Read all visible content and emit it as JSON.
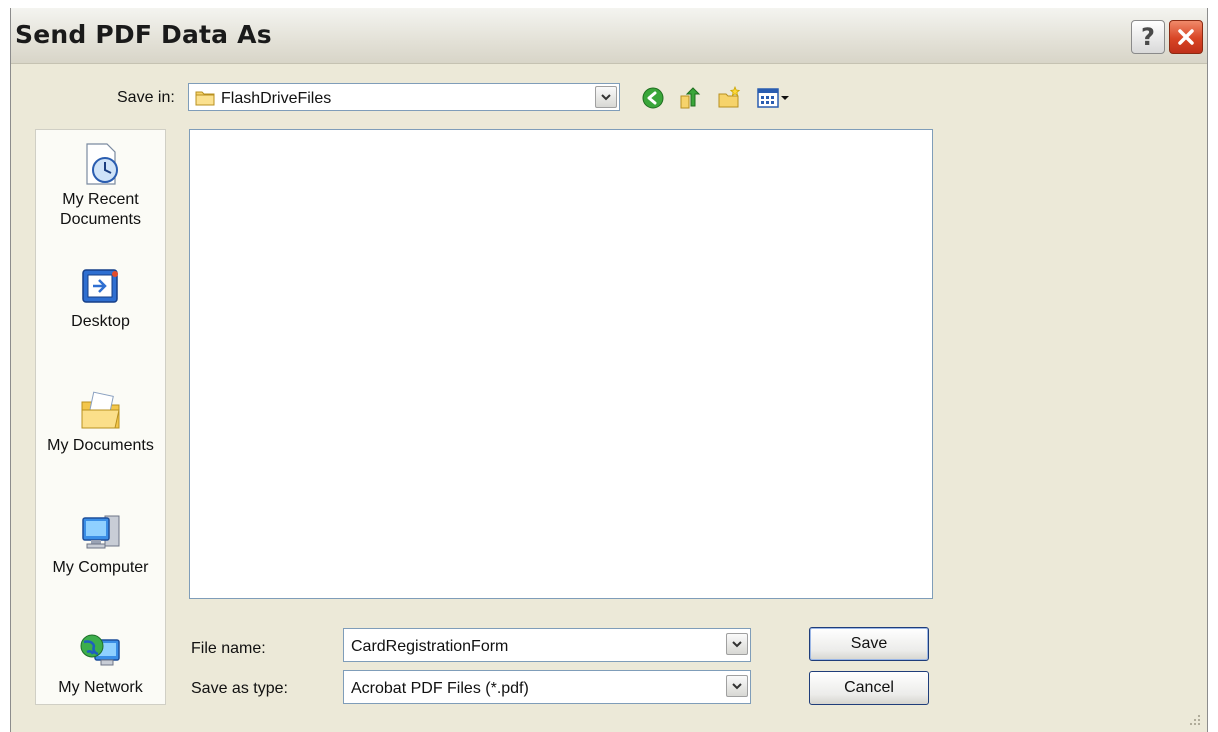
{
  "window": {
    "title": "Send PDF Data As",
    "help_icon": "help-icon",
    "close_icon": "close-icon"
  },
  "save_in": {
    "label": "Save in:",
    "value": "FlashDriveFiles",
    "icon": "folder-icon"
  },
  "toolbar": {
    "icons": [
      "back-icon",
      "up-folder-icon",
      "new-folder-icon",
      "view-menu-icon"
    ]
  },
  "places": [
    {
      "label": "My Recent Documents",
      "line1": "My Recent",
      "line2": "Documents",
      "icon": "recent-documents-icon"
    },
    {
      "label": "Desktop",
      "icon": "desktop-icon"
    },
    {
      "label": "My Documents",
      "icon": "my-documents-icon"
    },
    {
      "label": "My Computer",
      "icon": "my-computer-icon"
    },
    {
      "label": "My Network",
      "icon": "my-network-icon"
    }
  ],
  "file_name": {
    "label": "File name:",
    "value": "CardRegistrationForm"
  },
  "save_as_type": {
    "label": "Save as type:",
    "value": "Acrobat PDF Files (*.pdf)"
  },
  "buttons": {
    "save": "Save",
    "cancel": "Cancel"
  },
  "colors": {
    "dialog_bg": "#ece9d8",
    "close_button": "#d84525",
    "field_border": "#7f9db9"
  }
}
